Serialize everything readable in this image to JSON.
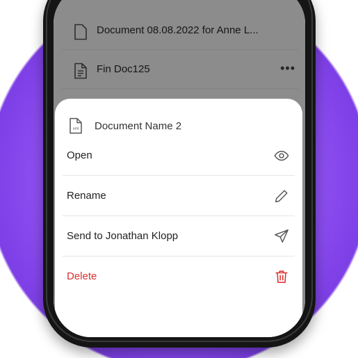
{
  "background_list": {
    "items": [
      {
        "name": "Document 08.08.2022 for Anne L..."
      },
      {
        "name": "Fin Doc125"
      }
    ],
    "more_glyph": "•••"
  },
  "sheet": {
    "file_name": "Document Name 2",
    "file_icon_label": "xml",
    "actions": [
      {
        "label": "Open",
        "icon": "eye-icon"
      },
      {
        "label": "Rename",
        "icon": "pencil-icon"
      },
      {
        "label": "Send to Jonathan Klopp",
        "icon": "send-icon"
      },
      {
        "label": "Delete",
        "icon": "trash-icon",
        "color": "#d9302f"
      }
    ]
  },
  "colors": {
    "accent_purple": "#8d4ff0",
    "danger": "#d9302f"
  }
}
